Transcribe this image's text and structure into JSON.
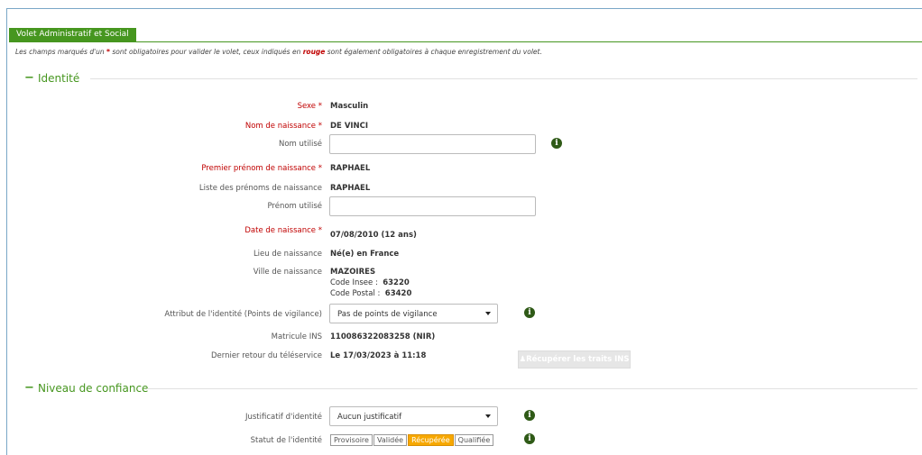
{
  "tab": {
    "label": "Volet Administratif et Social"
  },
  "notice": {
    "part1": "Les champs marqués d'un ",
    "star": "*",
    "part2": " sont obligatoires pour valider le volet, ceux indiqués en ",
    "rouge": "rouge",
    "part3": " sont également obligatoires à chaque enregistrement du volet."
  },
  "identite": {
    "title": "Identité",
    "sexe": {
      "label": "Sexe *",
      "value": "Masculin"
    },
    "nom_naissance": {
      "label": "Nom de naissance *",
      "value": "DE VINCI"
    },
    "nom_utilise": {
      "label": "Nom utilisé",
      "value": ""
    },
    "premier_prenom": {
      "label": "Premier prénom de naissance *",
      "value": "RAPHAEL"
    },
    "liste_prenoms": {
      "label": "Liste des prénoms de naissance",
      "value": "RAPHAEL"
    },
    "prenom_utilise": {
      "label": "Prénom utilisé",
      "value": ""
    },
    "date_naissance": {
      "label": "Date de naissance *",
      "value": "07/08/2010 (12 ans)"
    },
    "lieu_naissance": {
      "label": "Lieu de naissance",
      "value": "Né(e) en France"
    },
    "ville_naissance": {
      "label": "Ville de naissance",
      "value": "MAZOIRES",
      "insee_label": "Code Insee :",
      "insee": "63220",
      "postal_label": "Code Postal :",
      "postal": "63420"
    },
    "attribut": {
      "label": "Attribut de l'identité (Points de vigilance)",
      "selected": "Pas de points de vigilance"
    },
    "matricule": {
      "label": "Matricule INS",
      "value": "110086322083258 (NIR)"
    },
    "dernier_retour": {
      "label": "Dernier retour du téléservice",
      "value": "Le 17/03/2023 à 11:18"
    },
    "recuperer_button": "Récupérer les traits INS"
  },
  "confiance": {
    "title": "Niveau de confiance",
    "justificatif": {
      "label": "Justificatif d'identité",
      "selected": "Aucun justificatif"
    },
    "statut": {
      "label": "Statut de l'identité",
      "options": [
        "Provisoire",
        "Validée",
        "Récupérée",
        "Qualifiée"
      ],
      "active": "Récupérée"
    }
  },
  "info_glyph": "i",
  "colors": {
    "accent": "#46961f",
    "required": "#c00000",
    "active_status": "#f7a800"
  }
}
